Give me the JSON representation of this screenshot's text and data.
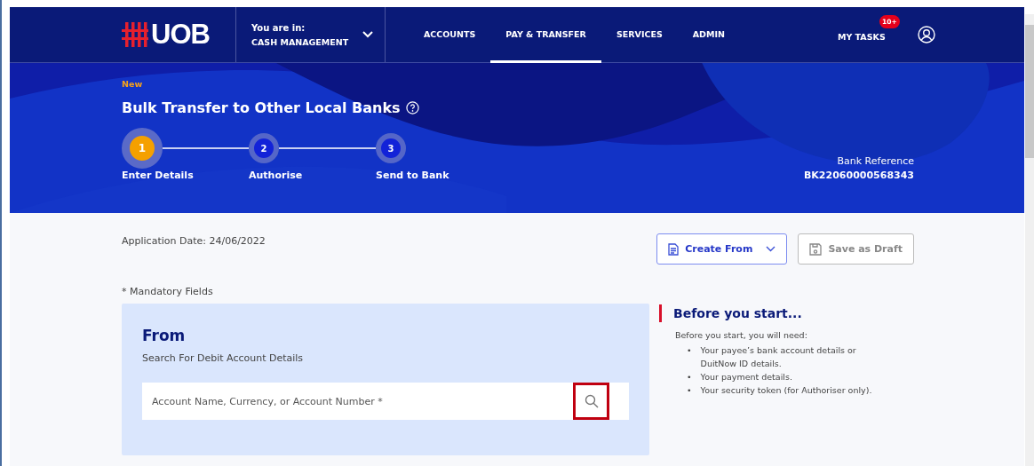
{
  "header": {
    "logo": "UOB",
    "context_label": "You are in:",
    "context_value": "CASH MANAGEMENT",
    "nav": [
      {
        "label": "ACCOUNTS",
        "selected": false
      },
      {
        "label": "PAY & TRANSFER",
        "selected": true
      },
      {
        "label": "SERVICES",
        "selected": false
      },
      {
        "label": "ADMIN",
        "selected": false
      }
    ],
    "tasks": {
      "label": "MY TASKS",
      "badge": "10+"
    }
  },
  "hero": {
    "tag": "New",
    "title": "Bulk Transfer to Other Local Banks",
    "steps": [
      {
        "number": "1",
        "label": "Enter Details",
        "selected": true
      },
      {
        "number": "2",
        "label": "Authorise",
        "selected": false
      },
      {
        "number": "3",
        "label": "Send to Bank",
        "selected": false
      }
    ],
    "reference_label": "Bank Reference",
    "reference_value": "BK22060000568343"
  },
  "application_date": "Application Date: 24/06/2022",
  "buttons": [
    {
      "label": "Create From",
      "kind": "dropdown"
    },
    {
      "label": "Save as Draft",
      "kind": "draft"
    }
  ],
  "mandatory_note": "* Mandatory Fields",
  "from_panel": {
    "title": "From",
    "subtitle": "Search For Debit Account Details",
    "placeholder": "Account Name, Currency, or Account Number *",
    "search_highlighted": true
  },
  "info": {
    "title": "Before you start...",
    "intro": "Before you start, you will need:",
    "items": [
      {
        "bullet": "•",
        "text": "Your payee’s bank account details or DuitNow ID details."
      },
      {
        "bullet": "•",
        "text": "Your payment details."
      },
      {
        "bullet": "•",
        "text": "Your security token (for Authoriser only)."
      }
    ]
  }
}
